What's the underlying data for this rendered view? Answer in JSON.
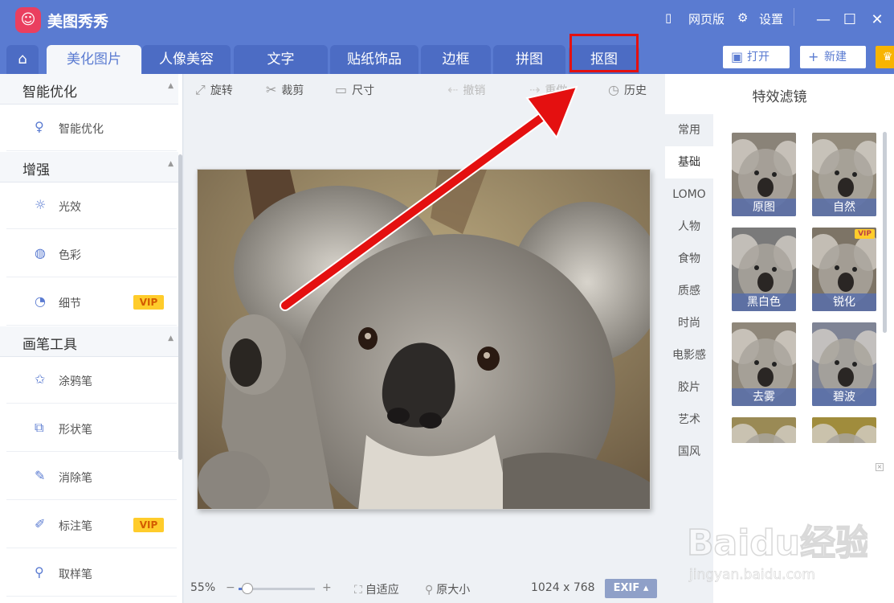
{
  "app": {
    "title": "美图秀秀",
    "logo_glyph": "☺"
  },
  "header_right": {
    "web_version": "网页版",
    "settings": "设置"
  },
  "window_controls": {
    "minimize": "—",
    "maximize": "☐",
    "close": "✕"
  },
  "tabs": [
    {
      "label": "美化图片",
      "active": true
    },
    {
      "label": "人像美容",
      "active": false
    },
    {
      "label": "文字",
      "active": false
    },
    {
      "label": "贴纸饰品",
      "active": false
    },
    {
      "label": "边框",
      "active": false
    },
    {
      "label": "拼图",
      "active": false
    },
    {
      "label": "抠图",
      "active": false
    }
  ],
  "header_buttons": {
    "open": "打开",
    "new": "新建"
  },
  "left_panel": {
    "sections": [
      {
        "title": "智能优化",
        "items": [
          {
            "label": "智能优化",
            "icon": "bulb-icon",
            "vip": false
          }
        ]
      },
      {
        "title": "增强",
        "items": [
          {
            "label": "光效",
            "icon": "sun-icon",
            "vip": false
          },
          {
            "label": "色彩",
            "icon": "palette-icon",
            "vip": false
          },
          {
            "label": "细节",
            "icon": "magnifier-icon",
            "vip": true
          }
        ]
      },
      {
        "title": "画笔工具",
        "items": [
          {
            "label": "涂鸦笔",
            "icon": "star-brush-icon",
            "vip": false
          },
          {
            "label": "形状笔",
            "icon": "shape-icon",
            "vip": false
          },
          {
            "label": "消除笔",
            "icon": "eraser-icon",
            "vip": false
          },
          {
            "label": "标注笔",
            "icon": "marker-icon",
            "vip": true
          },
          {
            "label": "取样笔",
            "icon": "dropper-icon",
            "vip": false
          }
        ]
      }
    ],
    "vip_label": "VIP"
  },
  "toolbar": {
    "rotate": "旋转",
    "crop": "裁剪",
    "size": "尺寸",
    "undo": "撤销",
    "redo": "重做",
    "history": "历史"
  },
  "bottom_bar": {
    "zoom": "55%",
    "zoom_level": 0.12,
    "fit": "自适应",
    "original": "原大小",
    "dimensions": "1024 x 768",
    "exif": "EXIF"
  },
  "effects": {
    "title": "特效滤镜",
    "categories": [
      {
        "label": "常用",
        "active": false
      },
      {
        "label": "基础",
        "active": true
      },
      {
        "label": "LOMO",
        "active": false
      },
      {
        "label": "人物",
        "active": false
      },
      {
        "label": "食物",
        "active": false
      },
      {
        "label": "质感",
        "active": false
      },
      {
        "label": "时尚",
        "active": false
      },
      {
        "label": "电影感",
        "active": false
      },
      {
        "label": "胶片",
        "active": false
      },
      {
        "label": "艺术",
        "active": false
      },
      {
        "label": "国风",
        "active": false
      }
    ],
    "thumbnails": [
      {
        "label": "原图",
        "vip": false,
        "tint": "#8a8378"
      },
      {
        "label": "自然",
        "vip": false,
        "tint": "#938b7c"
      },
      {
        "label": "黑白色",
        "vip": false,
        "tint": "#7a7a7a"
      },
      {
        "label": "锐化",
        "vip": true,
        "tint": "#7d7466"
      },
      {
        "label": "去雾",
        "vip": false,
        "tint": "#8f877a"
      },
      {
        "label": "碧波",
        "vip": false,
        "tint": "#7f8495"
      },
      {
        "label": "",
        "vip": false,
        "tint": "#9a8a55"
      },
      {
        "label": "",
        "vip": false,
        "tint": "#a08c3c"
      }
    ],
    "vip_badge": "VIP"
  },
  "watermark": {
    "brand": "Baidu经验",
    "url": "jingyan.baidu.com"
  },
  "colors": {
    "header": "#5a7bd1",
    "highlight": "#e41010",
    "vip": "#ffcc2b"
  }
}
